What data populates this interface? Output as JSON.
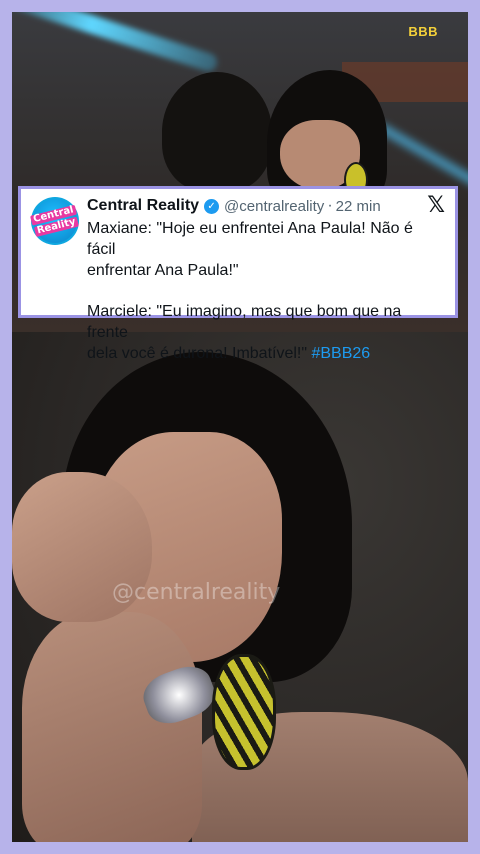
{
  "video": {
    "channel_logo": "BBB",
    "watermark": "@centralreality"
  },
  "tweet": {
    "avatar": {
      "line1": "Central",
      "line2": "Reality"
    },
    "display_name": "Central Reality",
    "verified_icon": "verified-badge-icon",
    "handle": "@centralreality",
    "separator": "·",
    "time": "22 min",
    "platform_icon": "x-logo-icon",
    "platform_glyph": "𝕏",
    "lines": [
      "Maxiane: \"Hoje eu enfrentei Ana Paula! Não é fácil",
      "enfrentar Ana Paula!\"",
      "Marciele: \"Eu imagino, mas que bom que na frente",
      "dela você é durona! Imbatível!\""
    ],
    "hashtag": "#BBB26"
  },
  "colors": {
    "border": "#b7b3ea",
    "card_border": "#9b93e4",
    "link": "#1d9bf0",
    "logo": "#f4d13a"
  }
}
